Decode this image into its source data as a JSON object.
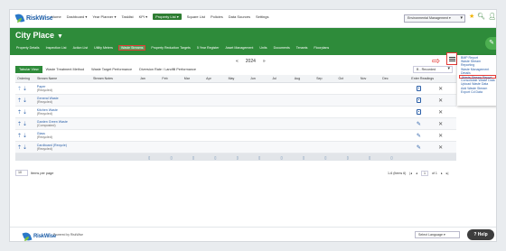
{
  "app": {
    "brand": "RiskWise"
  },
  "nav": {
    "items": [
      "Home",
      "Dashboard ▾",
      "Year Planner ▾",
      "Tasklist",
      "KPI ▾",
      "Property List ▾",
      "Square List",
      "Policies",
      "Data Sources",
      "Settings"
    ],
    "active_index": 5,
    "environment": "Environmental Management ▾"
  },
  "header": {
    "title": "City Place",
    "subnav": [
      "Property Details",
      "Inspection List",
      "Action List",
      "Utility Meters",
      "Waste Streams",
      "Property Reduction Targets",
      "5 Year Register",
      "Asset Management",
      "Units",
      "Documents",
      "Tenants",
      "Floorplans"
    ],
    "highlight_index": 4
  },
  "toolbar": {
    "year": "2024",
    "prev": "«»",
    "tabs": [
      "Tabular View",
      "Waste Treatment Method",
      "Waste Target Performance",
      "Diversion Rate / Landfill Performance"
    ],
    "active_tab": 0,
    "range": "B - Recorded"
  },
  "menu": {
    "items": [
      "BMP Report",
      "Waste Stream",
      "Reporting",
      "Waste Management",
      "Details",
      "Waste Stream Report",
      "Consolidate Waste Data",
      "Upload Waste Data",
      "Add Waste Stream",
      "Export Cd Data"
    ],
    "highlight_index": 5
  },
  "table": {
    "headers": {
      "order": "Ordering",
      "name": "Stream Name",
      "notes": "Stream Notes",
      "entry": "Enter Readings"
    },
    "months": [
      "Jan",
      "Feb",
      "Mar",
      "Apr",
      "May",
      "Jun",
      "Jul",
      "Aug",
      "Sep",
      "Oct",
      "Nov",
      "Dec"
    ],
    "rows": [
      {
        "name": "Paper",
        "status": "(Recycled)"
      },
      {
        "name": "General Waste",
        "status": "(Recycled)"
      },
      {
        "name": "Kitchen Waste",
        "status": "(Recycled)"
      },
      {
        "name": "Garden Green Waste",
        "status": "(Composted)"
      },
      {
        "name": "Glass",
        "status": "(Recycled)"
      },
      {
        "name": "Cardboard (Recycle)",
        "status": "(Recycled)"
      }
    ]
  },
  "pagination": {
    "per_page_label": "Items per page",
    "per_page": "10",
    "range": "1-6 (Items 6)",
    "page": "1",
    "of": "of 1"
  },
  "footer": {
    "powered": "Powered by RiskWise",
    "language": "Select Language ▾",
    "help": "Help"
  }
}
